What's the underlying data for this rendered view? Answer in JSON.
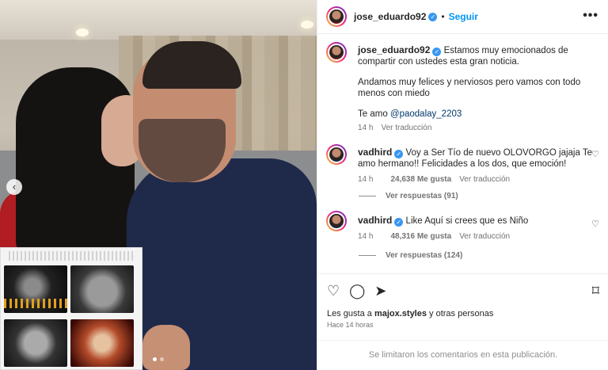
{
  "header": {
    "username": "jose_eduardo92",
    "follow_label": "Seguir",
    "separator": "•",
    "more_label": "•••"
  },
  "caption": {
    "username": "jose_eduardo92",
    "text1": "Estamos muy emocionados de compartir con ustedes esta gran noticia.",
    "text2": "Andamos muy felices y nerviosos pero vamos con todo menos con miedo",
    "text3_prefix": "Te amo ",
    "mention": "@paodalay_2203",
    "time": "14 h",
    "translate": "Ver traducción"
  },
  "comments": [
    {
      "username": "vadhird",
      "text": "Voy a Ser Tío de nuevo OLOVORGO jajaja Te amo hermano!! Felicidades a los dos, que emoción!",
      "time": "14 h",
      "likes": "24,638 Me gusta",
      "translate": "Ver traducción",
      "replies": "Ver respuestas (91)"
    },
    {
      "username": "vadhird",
      "text": "Like Aquí si crees que es Niño",
      "time": "14 h",
      "likes": "48,316 Me gusta",
      "translate": "Ver traducción",
      "replies": "Ver respuestas (124)"
    }
  ],
  "footer": {
    "likes_prefix": "Les gusta a ",
    "likes_user": "majox.styles",
    "likes_suffix": " y otras personas",
    "ago": "Hace 14 horas",
    "limited": "Se limitaron los comentarios en esta publicación."
  },
  "icons": {
    "prev": "‹",
    "heart": "♡",
    "comment": "◯",
    "share": "➤",
    "bookmark": "⌑",
    "verified": "✓"
  },
  "carousel": {
    "count": 2,
    "active_index": 0
  },
  "colors": {
    "accent": "#0095f6",
    "verified": "#3897f0"
  }
}
